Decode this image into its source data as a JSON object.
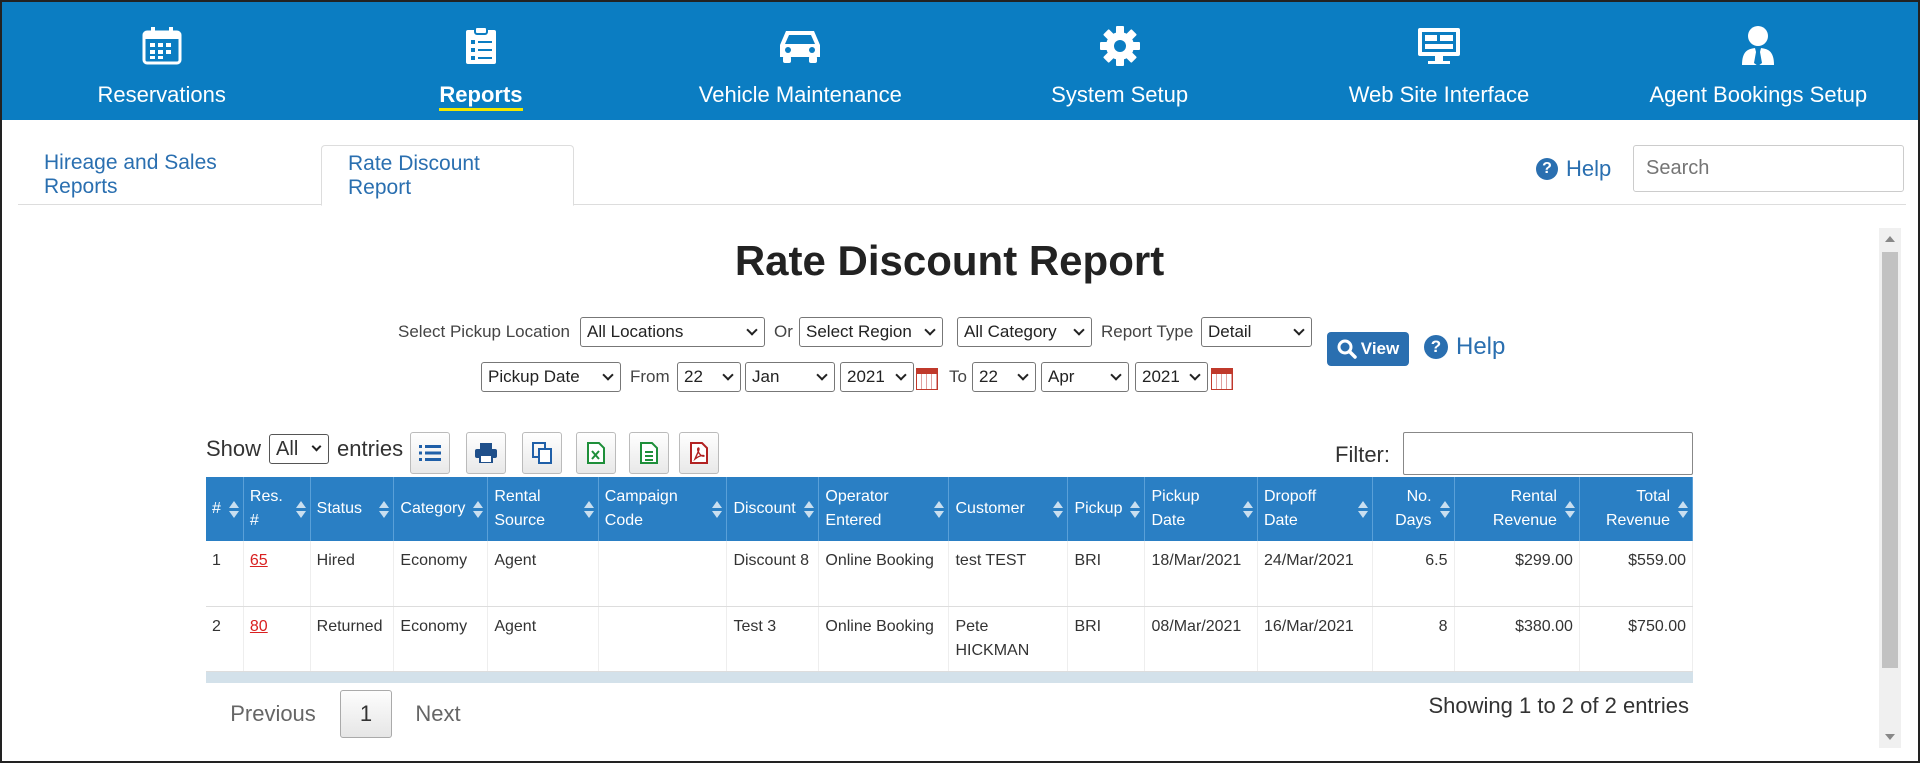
{
  "nav": {
    "items": [
      {
        "label": "Reservations",
        "icon": "calendar-icon"
      },
      {
        "label": "Reports",
        "icon": "clipboard-list-icon"
      },
      {
        "label": "Vehicle Maintenance",
        "icon": "car-icon"
      },
      {
        "label": "System Setup",
        "icon": "gear-icon"
      },
      {
        "label": "Web Site Interface",
        "icon": "monitor-icon"
      },
      {
        "label": "Agent Bookings Setup",
        "icon": "agent-icon"
      }
    ],
    "active": "Reports"
  },
  "tabs": {
    "hireage": "Hireage and Sales Reports",
    "rate_discount": "Rate Discount Report"
  },
  "top": {
    "help": "Help",
    "search_placeholder": "Search"
  },
  "report": {
    "title": "Rate Discount Report",
    "pickup_location_label": "Select Pickup Location",
    "pickup_location": "All Locations",
    "or_label": "Or",
    "region": "Select Region",
    "category": "All Category",
    "report_type_label": "Report Type",
    "report_type": "Detail",
    "date_type": "Pickup Date",
    "from_label": "From",
    "from_day": "22",
    "from_month": "Jan",
    "from_year": "2021",
    "to_label": "To",
    "to_day": "22",
    "to_month": "Apr",
    "to_year": "2021",
    "view_label": "View",
    "help_label": "Help"
  },
  "table_controls": {
    "show_label": "Show",
    "show_value": "All",
    "entries_label": "entries",
    "filter_label": "Filter:"
  },
  "table": {
    "headers": [
      "#",
      "Res. #",
      "Status",
      "Category",
      "Rental Source",
      "Campaign Code",
      "Discount",
      "Operator Entered",
      "Customer",
      "Pickup",
      "Pickup Date",
      "Dropoff Date",
      "No. Days",
      "Rental Revenue",
      "Total Revenue"
    ],
    "rows": [
      {
        "n": "1",
        "res": "65",
        "status": "Hired",
        "category": "Economy",
        "source": "Agent",
        "campaign": "",
        "discount": "Discount 8",
        "operator": "Online Booking",
        "customer": "test TEST",
        "pickup": "BRI",
        "pickup_date": "18/Mar/2021",
        "dropoff_date": "24/Mar/2021",
        "days": "6.5",
        "rental_rev": "$299.00",
        "total_rev": "$559.00"
      },
      {
        "n": "2",
        "res": "80",
        "status": "Returned",
        "category": "Economy",
        "source": "Agent",
        "campaign": "",
        "discount": "Test 3",
        "operator": "Online Booking",
        "customer": "Pete HICKMAN",
        "pickup": "BRI",
        "pickup_date": "08/Mar/2021",
        "dropoff_date": "16/Mar/2021",
        "days": "8",
        "rental_rev": "$380.00",
        "total_rev": "$750.00"
      }
    ]
  },
  "pager": {
    "previous": "Previous",
    "page": "1",
    "next": "Next",
    "info": "Showing 1 to 2 of 2 entries"
  },
  "colors": {
    "nav_bg": "#0b7dc2",
    "header_bg": "#2a7fc4",
    "link": "#2a6fb0",
    "res_link": "#d92020",
    "active_underline": "#f2e600"
  }
}
